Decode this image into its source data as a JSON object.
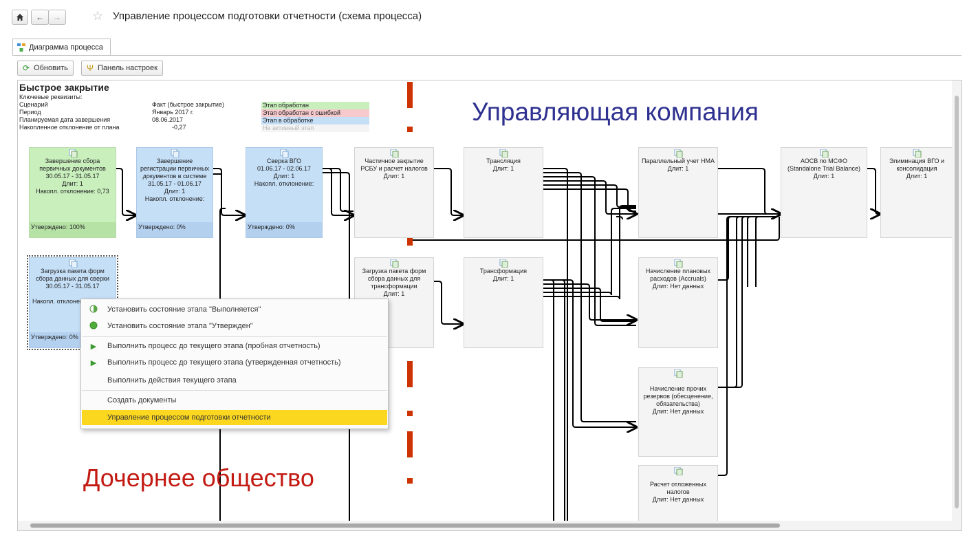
{
  "window": {
    "title": "Управление процессом подготовки отчетности (схема процесса)"
  },
  "tabs": [
    {
      "label": "Диаграмма процесса"
    }
  ],
  "toolbar": {
    "refresh_label": "Обновить",
    "settings_label": "Панель настроек"
  },
  "info": {
    "heading": "Быстрое закрытие",
    "subheading": "Ключевые реквизиты:",
    "rows": [
      {
        "label": "Сценарий",
        "value": "Факт (быстрое закрытие)"
      },
      {
        "label": "Период",
        "value": "Январь 2017 г."
      },
      {
        "label": "Планируемая дата завершения",
        "value": "08.06.2017"
      },
      {
        "label": "Накопленное отклонение от плана",
        "value": "-0,27"
      }
    ]
  },
  "legend": [
    {
      "label": "Этап обработан",
      "color": "#c9efbd"
    },
    {
      "label": "Этап обработан с ошибкой",
      "color": "#f6c9cc"
    },
    {
      "label": "Этап в обработке",
      "color": "#c5dff7"
    },
    {
      "label": "Не активный этап",
      "color": "#f4f4f4"
    }
  ],
  "regions": {
    "top": "Управляющая компания",
    "bottom": "Дочернее общество"
  },
  "divider_color": "#cc3300",
  "nodes": {
    "n1": {
      "lines": [
        "Завершение сбора",
        "первичных документов",
        "30.05.17 - 31.05.17",
        "Длит: 1",
        "Накопл. отклонение: 0,73"
      ],
      "footer": "Утверждено: 100%"
    },
    "n2": {
      "lines": [
        "Завершение",
        "регистрации первичных",
        "документов в системе",
        "31.05.17 - 01.06.17",
        "Длит: 1",
        "Накопл. отклонение:"
      ],
      "footer": "Утверждено: 0%"
    },
    "n3": {
      "lines": [
        "Сверка ВГО",
        "01.06.17 - 02.06.17",
        "Длит: 1",
        "Накопл. отклонение:"
      ],
      "footer": "Утверждено: 0%"
    },
    "n4": {
      "lines": [
        "Частичное закрытие",
        "РСБУ и расчет налогов",
        "Длит: 1"
      ]
    },
    "n5": {
      "lines": [
        "Трансляция",
        "Длит: 1"
      ]
    },
    "n6": {
      "lines": [
        "Параллельный учет НМА",
        "Длит: 1"
      ]
    },
    "n7": {
      "lines": [
        "АОСВ по МСФО",
        "(Standalone Trial Balance)",
        "Длит: 1"
      ]
    },
    "n8": {
      "lines": [
        "Элиминация ВГО и",
        "консолидация",
        "Длит: 1"
      ]
    },
    "n9": {
      "lines": [
        "Загрузка пакета форм",
        "сбора данных для сверки",
        "30.05.17 - 31.05.17"
      ],
      "acc": "Накопл. отклонение:",
      "footer": "Утверждено: 0%"
    },
    "n10": {
      "lines": [
        "Загрузка пакета форм",
        "сбора данных для",
        "трансформации",
        "Длит: 1"
      ]
    },
    "n11": {
      "lines": [
        "Трансформация",
        "Длит: 1"
      ]
    },
    "n12": {
      "lines": [
        "Начисление плановых",
        "расходов (Accruals)",
        "Длит: Нет данных"
      ]
    },
    "n13": {
      "lines": [
        "Начисление прочих",
        "резервов (обесценение,",
        "обязательства)",
        "Длит: Нет данных"
      ]
    },
    "n14": {
      "lines": [
        "Расчет отложенных",
        "налогов",
        "Длит: Нет данных"
      ]
    }
  },
  "context_menu": [
    {
      "label": "Установить состояние этапа \"Выполняется\"",
      "icon": "half-circle-icon"
    },
    {
      "label": "Установить состояние этапа \"Утвержден\"",
      "icon": "green-circle-icon"
    },
    {
      "label": "Выполнить процесс до текущего этапа (пробная отчетность)",
      "icon": "play-icon"
    },
    {
      "label": "Выполнить процесс до текущего этапа (утвержденная отчетность)",
      "icon": "play-icon"
    },
    {
      "label": "Выполнить действия текущего этапа",
      "icon": ""
    },
    {
      "label": "Создать документы",
      "icon": ""
    },
    {
      "label": "Управление процессом подготовки отчетности",
      "icon": "",
      "highlighted": true
    }
  ]
}
